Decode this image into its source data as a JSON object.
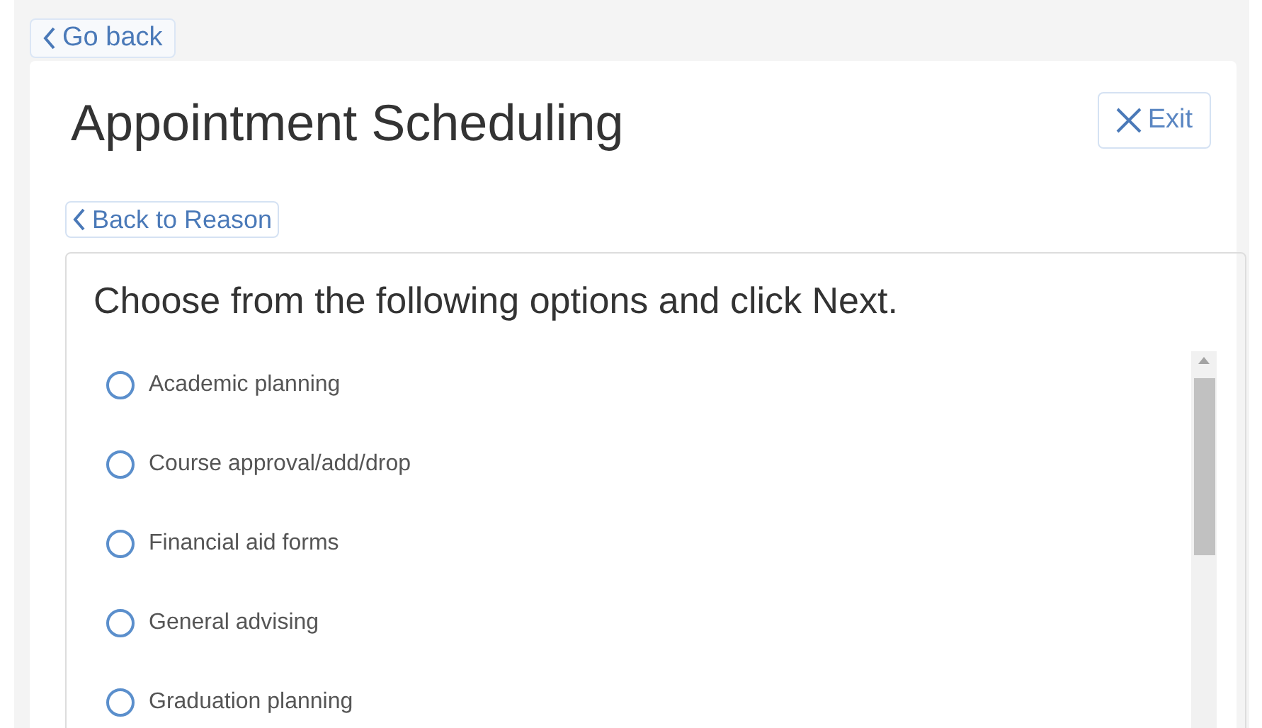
{
  "back_link": {
    "label": "Go back"
  },
  "title": "Appointment Scheduling",
  "exit_button": {
    "label": "Exit"
  },
  "back_to_reason": {
    "label": "Back to Reason"
  },
  "question": "Choose from the following options and click Next.",
  "options": [
    {
      "label": "Academic planning",
      "selected": false
    },
    {
      "label": "Course approval/add/drop",
      "selected": false
    },
    {
      "label": "Financial aid forms",
      "selected": false
    },
    {
      "label": "General advising",
      "selected": false
    },
    {
      "label": "Graduation planning",
      "selected": false
    }
  ]
}
